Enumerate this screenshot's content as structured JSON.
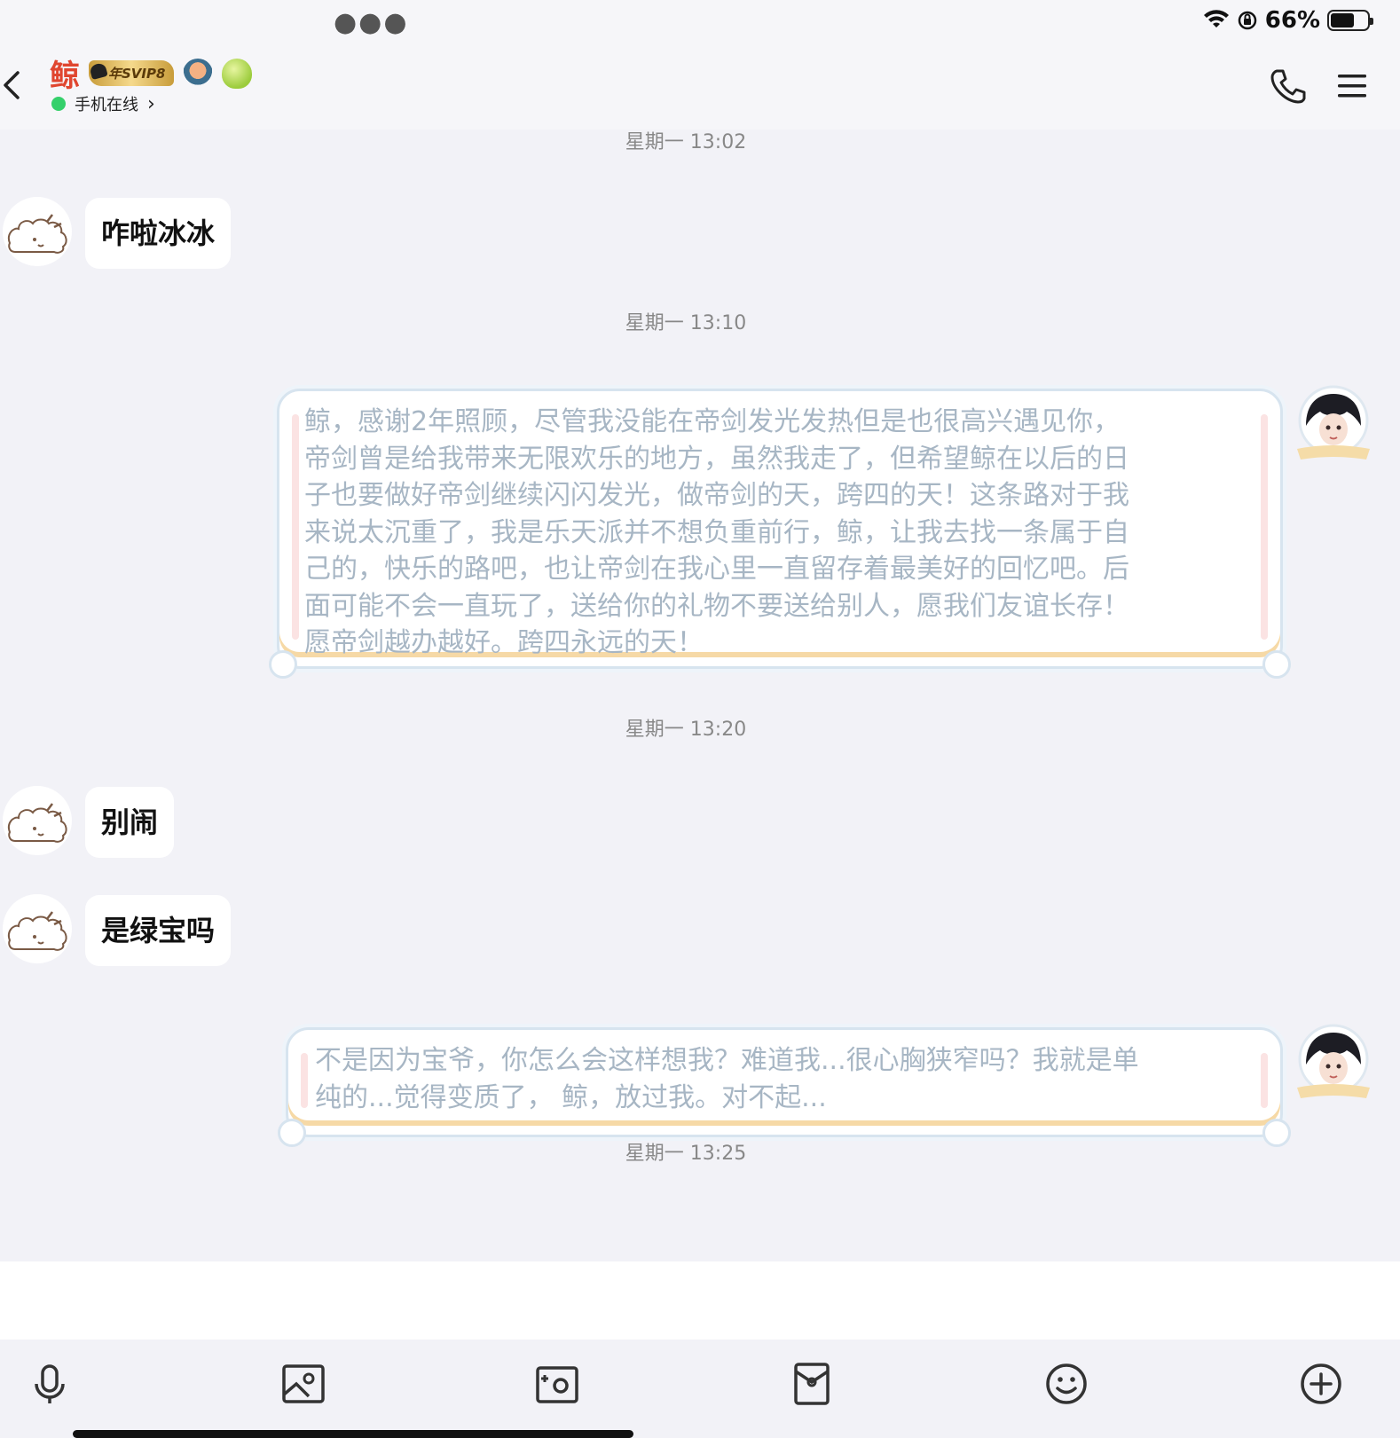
{
  "status_bar": {
    "battery_text": "66%",
    "battery_level": 0.66
  },
  "header": {
    "contact_name": "鲸",
    "vip_badge": "年SVIP8",
    "presence": "手机在线"
  },
  "chat": {
    "messages": [
      {
        "time": "星期一 13:02"
      },
      {
        "side": "left",
        "text": "咋啦冰冰"
      },
      {
        "time": "星期一 13:10"
      },
      {
        "side": "right",
        "lines": [
          "鲸，感谢2年照顾，尽管我没能在帝剑发光发热但是也很高兴遇见你，",
          "帝剑曾是给我带来无限欢乐的地方，虽然我走了，但希望鲸在以后的日",
          "子也要做好帝剑继续闪闪发光，做帝剑的天，跨四的天！这条路对于我",
          "来说太沉重了，我是乐天派并不想负重前行，鲸，让我去找一条属于自",
          "己的，快乐的路吧，也让帝剑在我心里一直留存着最美好的回忆吧。后",
          "面可能不会一直玩了，送给你的礼物不要送给别人，愿我们友谊长存！",
          "愿帝剑越办越好。跨四永远的天！"
        ]
      },
      {
        "time": "星期一 13:20"
      },
      {
        "side": "left",
        "text": "别闹"
      },
      {
        "side": "left",
        "text": "是绿宝吗"
      },
      {
        "side": "right",
        "lines": [
          "不是因为宝爷，你怎么会这样想我？难道我...很心胸狭窄吗？我就是单",
          "纯的...觉得变质了，  鲸，放过我。对不起..."
        ]
      },
      {
        "time": "星期一 13:25"
      }
    ]
  },
  "toolbar": {
    "icons": [
      "microphone-icon",
      "image-icon",
      "camera-icon",
      "red-packet-icon",
      "emoji-icon",
      "plus-icon"
    ]
  },
  "colors": {
    "presence": "#35d06b",
    "contact_name": "#e0462f",
    "deco_text": "#a7b6c4"
  }
}
